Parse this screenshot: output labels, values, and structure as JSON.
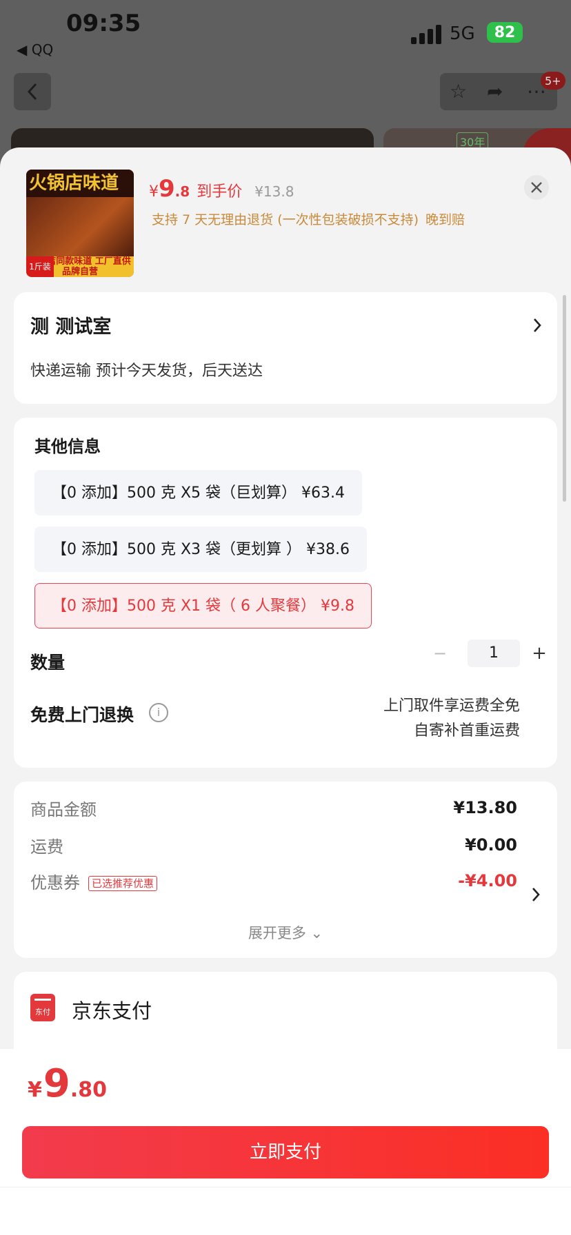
{
  "status_bar": {
    "time": "09:35",
    "back_app": "◀ QQ",
    "network": "5G",
    "battery": "82"
  },
  "background_page": {
    "notification_badge": "5+",
    "banner_tag": "30年"
  },
  "product": {
    "thumbnail_title": "火锅店味道",
    "thumbnail_caption": "火锅店同款味道 工厂直供 品牌自营",
    "thumbnail_weight": "1斤装",
    "price_symbol": "¥",
    "price_int": "9",
    "price_dec": ".8",
    "price_label": "到手价",
    "original_price": "¥13.8",
    "promise": "支持 7 天无理由退货 (一次性包装破损不支持)",
    "late_compensation": "晚到赔"
  },
  "address": {
    "title": "测  测试室",
    "shipping": "快递运输 预计今天发货，后天送达"
  },
  "options": {
    "title": "其他信息",
    "items": [
      {
        "label": "【0 添加】500 克 X5 袋（巨划算） ¥63.4",
        "selected": false
      },
      {
        "label": "【0 添加】500 克 X3 袋（更划算 ） ¥38.6",
        "selected": false
      },
      {
        "label": "【0 添加】500 克 X1 袋（ 6 人聚餐） ¥9.8",
        "selected": true
      }
    ]
  },
  "quantity": {
    "label": "数量",
    "value": "1",
    "minus": "−",
    "plus": "+"
  },
  "returns": {
    "label": "免费上门退换",
    "line1": "上门取件享运费全免",
    "line2": "自寄补首重运费"
  },
  "cost": {
    "goods_label": "商品金额",
    "goods_value": "¥13.80",
    "shipping_label": "运费",
    "shipping_value": "¥0.00",
    "coupon_label": "优惠券",
    "coupon_tag": "已选推荐优惠",
    "coupon_value": "-¥4.00",
    "expand": "展开更多"
  },
  "payment": {
    "method": "京东支付",
    "icon_text": "东付"
  },
  "footer": {
    "total_symbol": "¥",
    "total_int": "9",
    "total_dec": ".80",
    "pay_button": "立即支付"
  },
  "colors": {
    "accent": "#e4393c",
    "promise": "#c98a3a",
    "battery": "#2ec04b"
  }
}
